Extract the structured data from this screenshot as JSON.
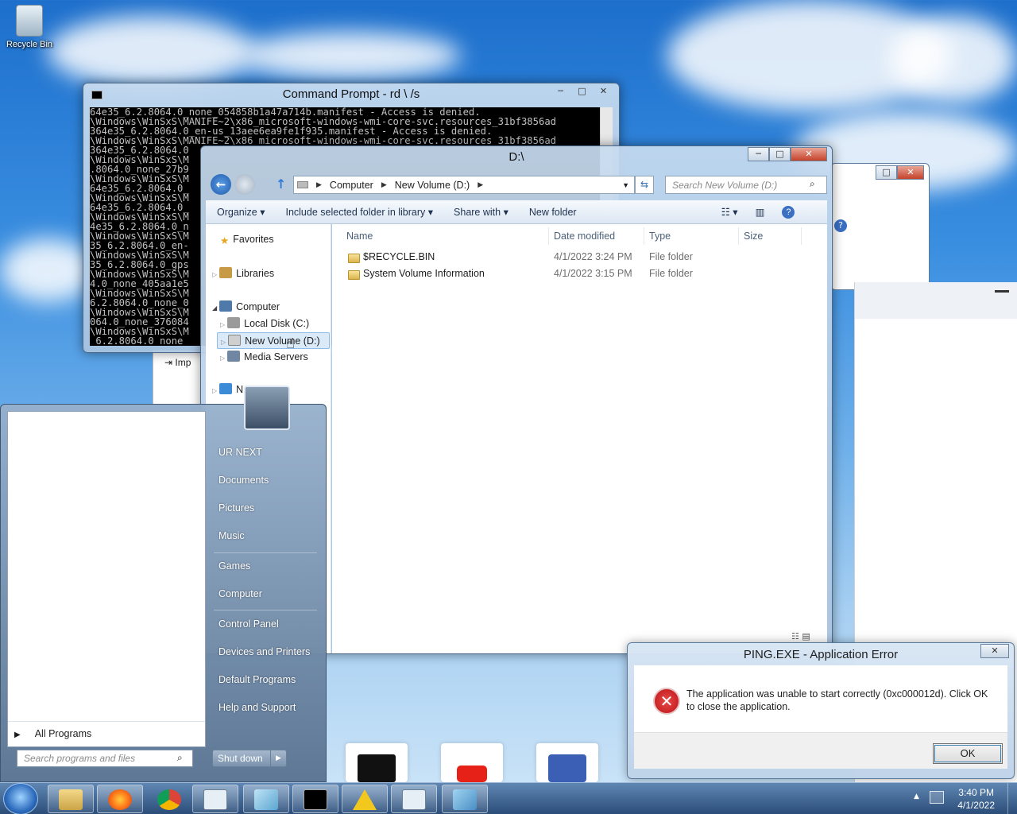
{
  "desktop": {
    "recycle_bin_label": "Recycle Bin"
  },
  "cmd": {
    "title": "Command Prompt - rd  \\ /s",
    "lines": [
      "64e35_6.2.8064.0_none_054858b1a47a714b.manifest - Access is denied.",
      "\\Windows\\WinSxS\\MANIFE~2\\x86_microsoft-windows-wmi-core-svc.resources_31bf3856ad",
      "364e35_6.2.8064.0_en-us_13aee6ea9fe1f935.manifest - Access is denied.",
      "\\Windows\\WinSxS\\MANIFE~2\\x86_microsoft-windows-wmi-core-svc.resources_31bf3856ad",
      "364e35_6.2.8064.0",
      "\\Windows\\WinSxS\\M",
      ".8064.0_none_27b9",
      "\\Windows\\WinSxS\\M",
      "64e35_6.2.8064.0_",
      "\\Windows\\WinSxS\\M",
      "64e35_6.2.8064.0_",
      "\\Windows\\WinSxS\\M",
      "4e35_6.2.8064.0_n",
      "\\Windows\\WinSxS\\M",
      "35_6.2.8064.0_en-",
      "\\Windows\\WinSxS\\M",
      "35_6.2.8064.0_gps",
      "\\Windows\\WinSxS\\M",
      "4.0_none_405aa1e5",
      "\\Windows\\WinSxS\\M",
      "6.2.8064.0_none_0",
      "\\Windows\\WinSxS\\M",
      "064.0_none_376084",
      "\\Windows\\WinSxS\\M",
      "_6.2.8064.0_none "
    ]
  },
  "explorer": {
    "title": "D:\\",
    "breadcrumb": [
      "Computer",
      "New Volume (D:)"
    ],
    "search_placeholder": "Search New Volume (D:)",
    "toolbar": {
      "organize": "Organize",
      "include": "Include selected folder in library",
      "share": "Share with",
      "new_folder": "New folder"
    },
    "nav": {
      "favorites": "Favorites",
      "libraries": "Libraries",
      "computer": "Computer",
      "local_disk": "Local Disk (C:)",
      "new_volume": "New Volume (D:)",
      "media_servers": "Media Servers",
      "network": "N"
    },
    "columns": {
      "name": "Name",
      "date": "Date modified",
      "type": "Type",
      "size": "Size"
    },
    "files": [
      {
        "name": "$RECYCLE.BIN",
        "date": "4/1/2022 3:24 PM",
        "type": "File folder"
      },
      {
        "name": "System Volume Information",
        "date": "4/1/2022 3:15 PM",
        "type": "File folder"
      }
    ]
  },
  "bg_window": {
    "import_label": "Imp"
  },
  "start_menu": {
    "right_items": [
      "UR NEXT",
      "Documents",
      "Pictures",
      "Music",
      "Games",
      "Computer",
      "Control Panel",
      "Devices and Printers",
      "Default Programs",
      "Help and Support"
    ],
    "all_programs": "All Programs",
    "search_placeholder": "Search programs and files",
    "shutdown": "Shut down"
  },
  "dialog": {
    "title": "PING.EXE - Application Error",
    "message": "The application was unable to start correctly (0xc000012d). Click OK to close the application.",
    "ok": "OK"
  },
  "taskbar": {
    "time": "3:40 PM",
    "date": "4/1/2022"
  },
  "colors": {
    "accent": "#1e6ec8",
    "error_red": "#c4232b",
    "link": "#1e3250"
  }
}
